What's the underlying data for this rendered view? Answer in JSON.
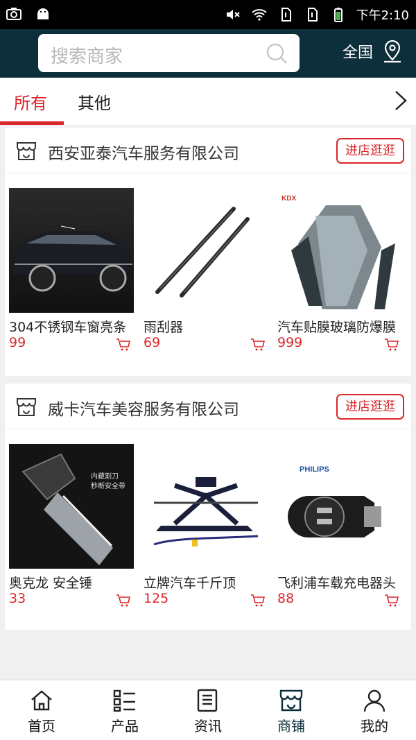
{
  "statusbar": {
    "time": "下午2:10",
    "icons": [
      "camera-icon",
      "android-icon",
      "mute-icon",
      "wifi-icon",
      "sim1-icon",
      "sim2-icon",
      "battery-icon"
    ]
  },
  "header": {
    "search_placeholder": "搜索商家",
    "region": "全国",
    "icons": [
      "search-icon",
      "location-icon"
    ]
  },
  "tabs": [
    {
      "label": "所有",
      "active": true
    },
    {
      "label": "其他",
      "active": false
    }
  ],
  "shops": [
    {
      "name": "西安亚泰汽车服务有限公司",
      "visit_label": "进店逛逛",
      "products": [
        {
          "name": "304不锈钢车窗亮条",
          "price": "99",
          "image": "black-suv-photo"
        },
        {
          "name": "雨刮器",
          "price": "69",
          "image": "wiper-blades-photo"
        },
        {
          "name": "汽车贴膜玻璃防爆膜",
          "price": "999",
          "image": "window-film-rolls-photo"
        }
      ]
    },
    {
      "name": "威卡汽车美容服务有限公司",
      "visit_label": "进店逛逛",
      "products": [
        {
          "name": "奥克龙 安全锤",
          "price": "33",
          "image": "safety-hammer-photo"
        },
        {
          "name": "立牌汽车千斤顶",
          "price": "125",
          "image": "scissor-jack-photo"
        },
        {
          "name": "飞利浦车载充电器头",
          "price": "88",
          "image": "car-charger-photo"
        }
      ]
    }
  ],
  "product_image_text": {
    "film_brand": "KDX",
    "hammer_caption_1": "内藏割刀",
    "hammer_caption_2": "秒断安全带",
    "charger_brand": "PHILIPS"
  },
  "colors": {
    "accent": "#d9262a",
    "header_bg": "#0c2f3b",
    "page_bg": "#f0f0f0"
  },
  "bottom_nav": [
    {
      "label": "首页",
      "icon": "home-icon",
      "active": false
    },
    {
      "label": "产品",
      "icon": "product-list-icon",
      "active": false
    },
    {
      "label": "资讯",
      "icon": "news-icon",
      "active": false
    },
    {
      "label": "商铺",
      "icon": "shop-icon",
      "active": true
    },
    {
      "label": "我的",
      "icon": "user-icon",
      "active": false
    }
  ]
}
